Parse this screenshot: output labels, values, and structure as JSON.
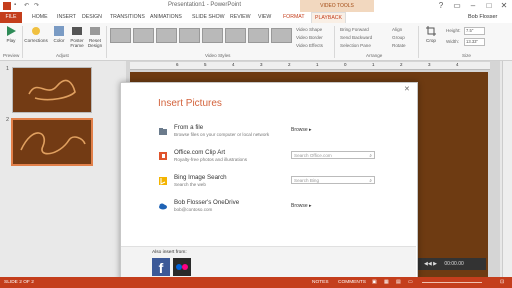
{
  "titlebar": {
    "title": "Presentation1 - PowerPoint",
    "context_tab": "VIDEO TOOLS",
    "window_controls": [
      "?",
      "▭",
      "–",
      "□",
      "✕"
    ]
  },
  "tabs": [
    "FILE",
    "HOME",
    "INSERT",
    "DESIGN",
    "TRANSITIONS",
    "ANIMATIONS",
    "SLIDE SHOW",
    "REVIEW",
    "VIEW",
    "FORMAT",
    "PLAYBACK"
  ],
  "user": "Bob Flosser",
  "ribbon": {
    "play": "Play",
    "corrections": "Corrections",
    "color": "Color",
    "poster_frame": "Poster\nFrame",
    "reset_design": "Reset\nDesign",
    "groups": [
      "Preview",
      "Adjust",
      "Video Styles",
      "Arrange",
      "Size"
    ],
    "video_shape": "Video Shape",
    "video_border": "Video Border",
    "video_effects": "Video Effects",
    "bring_forward": "Bring Forward",
    "send_backward": "Send Backward",
    "selection_pane": "Selection Pane",
    "align": "Align",
    "group": "Group",
    "rotate": "Rotate",
    "crop": "Crop",
    "height_label": "Height:",
    "height_value": "7.5\"",
    "width_label": "Width:",
    "width_value": "13.33\""
  },
  "slides": [
    "1",
    "2"
  ],
  "ruler_marks": [
    "6",
    "5",
    "4",
    "3",
    "2",
    "1",
    "0",
    "1",
    "2",
    "3",
    "4",
    "5",
    "6"
  ],
  "dialog": {
    "title": "Insert Pictures",
    "close": "✕",
    "rows": [
      {
        "icon": "folder-icon",
        "title": "From a file",
        "subtitle": "Browse files on your computer or local network",
        "action": "Browse ▸"
      },
      {
        "icon": "office-icon",
        "title": "Office.com Clip Art",
        "subtitle": "Royalty-free photos and illustrations",
        "search_placeholder": "Search Office.com"
      },
      {
        "icon": "bing-icon",
        "title": "Bing Image Search",
        "subtitle": "Search the web",
        "search_placeholder": "Search Bing"
      },
      {
        "icon": "onedrive-icon",
        "title": "Bob Flosser's OneDrive",
        "subtitle": "bob@contoso.com",
        "action": "Browse ▸"
      }
    ],
    "also_insert": "Also insert from:",
    "facebook_glyph": "f"
  },
  "player_time": "00:00.00",
  "statusbar": {
    "slide": "SLIDE 2 OF 2",
    "notes": "NOTES",
    "comments": "COMMENTS"
  },
  "colors": {
    "accent": "#c43e1c",
    "slide_bg": "#6e3b12",
    "dialog_title": "#d3623b"
  }
}
